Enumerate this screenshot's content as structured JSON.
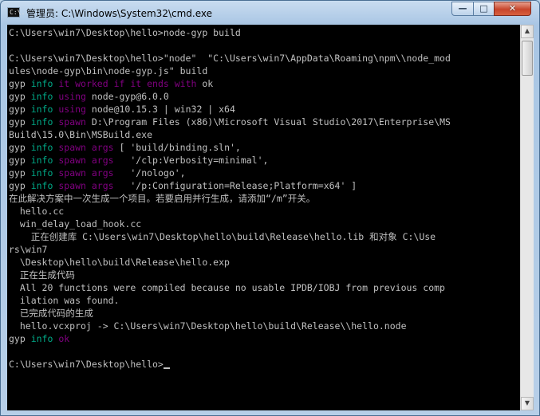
{
  "window": {
    "title": "管理员: C:\\Windows\\System32\\cmd.exe",
    "icon": "cmd-icon",
    "icon_text": "C:\\.",
    "controls": {
      "minimize": "—",
      "maximize": "□",
      "close": "✕"
    }
  },
  "colors": {
    "info": "#00aa88",
    "verb": "#800080",
    "text": "#c0c0c0",
    "background": "#000000"
  },
  "console": {
    "lines": [
      [
        {
          "t": "C:\\Users\\win7\\Desktop\\hello>node-gyp build"
        }
      ],
      [
        {
          "t": ""
        }
      ],
      [
        {
          "t": "C:\\Users\\win7\\Desktop\\hello>\"node\"  \"C:\\Users\\win7\\AppData\\Roaming\\npm\\\\node_mod"
        }
      ],
      [
        {
          "t": "ules\\node-gyp\\bin\\node-gyp.js\" build"
        }
      ],
      [
        {
          "t": "gyp "
        },
        {
          "t": "info",
          "c": "info"
        },
        {
          "t": " "
        },
        {
          "t": "it worked if it ends with",
          "c": "verb"
        },
        {
          "t": " ok"
        }
      ],
      [
        {
          "t": "gyp "
        },
        {
          "t": "info",
          "c": "info"
        },
        {
          "t": " "
        },
        {
          "t": "using",
          "c": "verb"
        },
        {
          "t": " node-gyp@6.0.0"
        }
      ],
      [
        {
          "t": "gyp "
        },
        {
          "t": "info",
          "c": "info"
        },
        {
          "t": " "
        },
        {
          "t": "using",
          "c": "verb"
        },
        {
          "t": " node@10.15.3 | win32 | x64"
        }
      ],
      [
        {
          "t": "gyp "
        },
        {
          "t": "info",
          "c": "info"
        },
        {
          "t": " "
        },
        {
          "t": "spawn",
          "c": "verb"
        },
        {
          "t": " D:\\Program Files (x86)\\Microsoft Visual Studio\\2017\\Enterprise\\MS"
        }
      ],
      [
        {
          "t": "Build\\15.0\\Bin\\MSBuild.exe"
        }
      ],
      [
        {
          "t": "gyp "
        },
        {
          "t": "info",
          "c": "info"
        },
        {
          "t": " "
        },
        {
          "t": "spawn args",
          "c": "verb"
        },
        {
          "t": " [ 'build/binding.sln',"
        }
      ],
      [
        {
          "t": "gyp "
        },
        {
          "t": "info",
          "c": "info"
        },
        {
          "t": " "
        },
        {
          "t": "spawn args",
          "c": "verb"
        },
        {
          "t": "   '/clp:Verbosity=minimal',"
        }
      ],
      [
        {
          "t": "gyp "
        },
        {
          "t": "info",
          "c": "info"
        },
        {
          "t": " "
        },
        {
          "t": "spawn args",
          "c": "verb"
        },
        {
          "t": "   '/nologo',"
        }
      ],
      [
        {
          "t": "gyp "
        },
        {
          "t": "info",
          "c": "info"
        },
        {
          "t": " "
        },
        {
          "t": "spawn args",
          "c": "verb"
        },
        {
          "t": "   '/p:Configuration=Release;Platform=x64' ]"
        }
      ],
      [
        {
          "t": "在此解决方案中一次生成一个项目。若要启用并行生成，请添加“/m”开关。"
        }
      ],
      [
        {
          "t": "  hello.cc"
        }
      ],
      [
        {
          "t": "  win_delay_load_hook.cc"
        }
      ],
      [
        {
          "t": "    正在创建库 C:\\Users\\win7\\Desktop\\hello\\build\\Release\\hello.lib 和对象 C:\\Use"
        }
      ],
      [
        {
          "t": "rs\\win7"
        }
      ],
      [
        {
          "t": "  \\Desktop\\hello\\build\\Release\\hello.exp"
        }
      ],
      [
        {
          "t": "  正在生成代码"
        }
      ],
      [
        {
          "t": "  All 20 functions were compiled because no usable IPDB/IOBJ from previous comp"
        }
      ],
      [
        {
          "t": "  ilation was found."
        }
      ],
      [
        {
          "t": "  已完成代码的生成"
        }
      ],
      [
        {
          "t": "  hello.vcxproj -> C:\\Users\\win7\\Desktop\\hello\\build\\Release\\\\hello.node"
        }
      ],
      [
        {
          "t": "gyp "
        },
        {
          "t": "info",
          "c": "info"
        },
        {
          "t": " "
        },
        {
          "t": "ok",
          "c": "verb"
        },
        {
          "t": " "
        }
      ],
      [
        {
          "t": ""
        }
      ],
      [
        {
          "t": "C:\\Users\\win7\\Desktop\\hello>"
        }
      ]
    ]
  },
  "scrollbar": {
    "up": "▲",
    "down": "▼"
  }
}
